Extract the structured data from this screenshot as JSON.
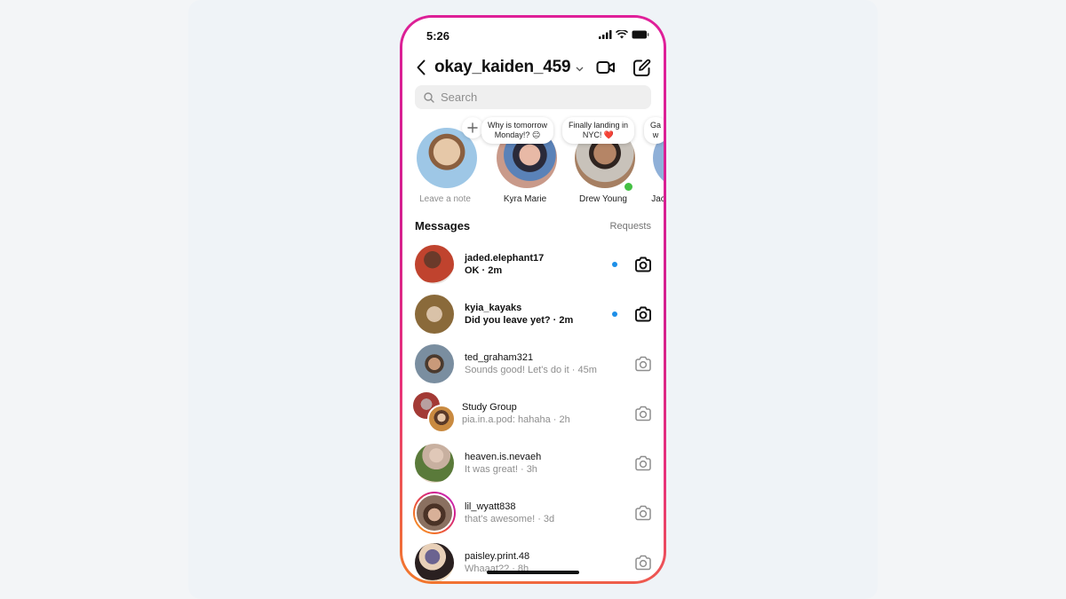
{
  "status_bar": {
    "time": "5:26",
    "icons": [
      "cellular-signal-icon",
      "wifi-icon",
      "battery-icon"
    ]
  },
  "header": {
    "username": "okay_kaiden_459",
    "back_icon": "chevron-left-icon",
    "dropdown_icon": "chevron-down-icon",
    "actions": [
      "video-call-icon",
      "compose-icon"
    ]
  },
  "search": {
    "placeholder": "Search",
    "value": ""
  },
  "notes": [
    {
      "name": "Leave a note",
      "note": "",
      "is_self": true,
      "avatar_color": "#b8a48a"
    },
    {
      "name": "Kyra Marie",
      "note": "Why is tomorrow Monday!? 😑",
      "avatar_color": "#9c6f68"
    },
    {
      "name": "Drew Young",
      "note": "Finally landing in NYC! ❤️",
      "online": true,
      "avatar_color": "#8a6b55"
    },
    {
      "name": "Jac",
      "note": "Ga w",
      "truncated": true,
      "avatar_color": "#7a4a3a"
    }
  ],
  "notes_display": {
    "n1_line1": "Why is tomorrow",
    "n1_line2": "Monday!? 😑",
    "n2_line1": "Finally landing in",
    "n2_line2": "NYC! ❤️",
    "n3_line1": "Ga",
    "n3_line2": "w"
  },
  "messages": {
    "title": "Messages",
    "requests_label": "Requests",
    "threads": [
      {
        "name": "jaded.elephant17",
        "preview": "OK · 2m",
        "unread": true,
        "avatar_color": "#c0432e"
      },
      {
        "name": "kyia_kayaks",
        "preview": "Did you leave yet? · 2m",
        "unread": true,
        "avatar_color": "#b08a5a"
      },
      {
        "name": "ted_graham321",
        "preview": "Sounds good! Let's do it · 45m",
        "unread": false,
        "avatar_color": "#6f7e8c"
      },
      {
        "name": "Study Group",
        "preview": "pia.in.a.pod: hahaha · 2h",
        "unread": false,
        "group": true,
        "avatar_colors": [
          "#a33a35",
          "#c98a40"
        ]
      },
      {
        "name": "heaven.is.nevaeh",
        "preview": "It was great! · 3h",
        "unread": false,
        "avatar_color": "#7a8a5a"
      },
      {
        "name": "lil_wyatt838",
        "preview": "that's awesome! · 3d",
        "unread": false,
        "story_ring": true,
        "avatar_color": "#8a6e5e"
      },
      {
        "name": "paisley.print.48",
        "preview": "Whaaat?? · 8h",
        "unread": false,
        "avatar_color": "#6b6390"
      }
    ]
  },
  "colors": {
    "border_gradient_top": "#e0209a",
    "border_gradient_bottom": "#f27a2a",
    "unread_dot": "#1d8fe8",
    "online_dot": "#44c044"
  }
}
